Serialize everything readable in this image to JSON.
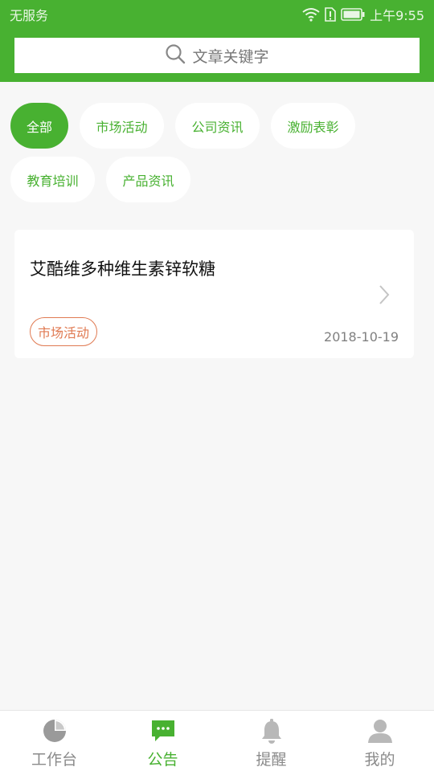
{
  "status_bar": {
    "carrier": "无服务",
    "time": "上午9:55"
  },
  "search": {
    "placeholder": "文章关键字"
  },
  "categories": [
    {
      "label": "全部",
      "active": true
    },
    {
      "label": "市场活动",
      "active": false
    },
    {
      "label": "公司资讯",
      "active": false
    },
    {
      "label": "激励表彰",
      "active": false
    },
    {
      "label": "教育培训",
      "active": false
    },
    {
      "label": "产品资讯",
      "active": false
    }
  ],
  "articles": [
    {
      "title": "艾酷维多种维生素锌软糖",
      "tag": "市场活动",
      "date": "2018-10-19"
    }
  ],
  "tabbar": {
    "items": [
      {
        "label": "工作台",
        "icon": "pie-chart-icon",
        "active": false
      },
      {
        "label": "公告",
        "icon": "message-icon",
        "active": true
      },
      {
        "label": "提醒",
        "icon": "bell-icon",
        "active": false
      },
      {
        "label": "我的",
        "icon": "person-icon",
        "active": false
      }
    ]
  },
  "colors": {
    "brand_green": "#48b131",
    "tag_orange": "#e07a52",
    "background": "#f7f7f7"
  }
}
